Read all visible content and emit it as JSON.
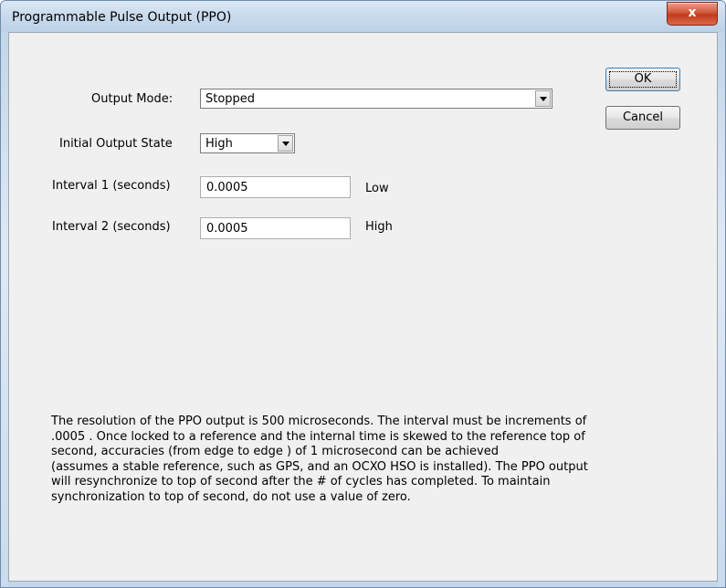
{
  "window": {
    "title": "Programmable Pulse Output (PPO)",
    "close_label": "x"
  },
  "form": {
    "output_mode": {
      "label": "Output Mode:",
      "value": "Stopped"
    },
    "initial_state": {
      "label": "Initial Output State",
      "value": "High"
    },
    "interval1": {
      "label": "Interval 1 (seconds)",
      "value": "0.0005",
      "suffix": "Low"
    },
    "interval2": {
      "label": "Interval 2 (seconds)",
      "value": "0.0005",
      "suffix": "High"
    }
  },
  "buttons": {
    "ok": "OK",
    "cancel": "Cancel"
  },
  "note": {
    "lines": [
      "The resolution of the PPO output is 500 microseconds. The interval must be increments of",
      ".0005 . Once locked to a reference and the internal time is skewed to the reference top of",
      "second, accuracies (from edge to edge ) of 1 microsecond can be achieved",
      "(assumes a stable reference, such as GPS, and an OCXO HSO is installed). The PPO output",
      "will resynchronize to top of second after the # of cycles has completed. To maintain",
      "synchronization to top of second, do not use a value of zero."
    ]
  }
}
